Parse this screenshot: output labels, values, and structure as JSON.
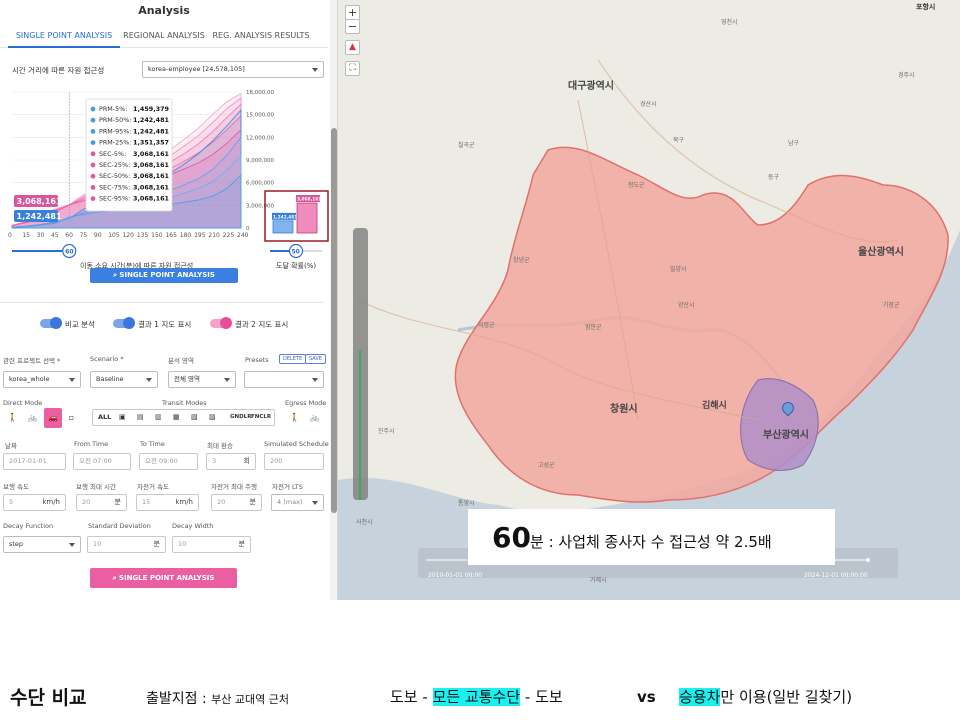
{
  "panel": {
    "title": "Analysis",
    "tabs": [
      {
        "label": "SINGLE POINT ANALYSIS",
        "active": true
      },
      {
        "label": "REGIONAL ANALYSIS",
        "active": false
      },
      {
        "label": "REG. ANALYSIS RESULTS",
        "active": false
      }
    ],
    "chart_section_label": "시간 거리에 따른 자원 접근성",
    "dataset_select": "korea-employee [24,578,105]"
  },
  "chart_data": [
    {
      "type": "area",
      "x": [
        0,
        15,
        30,
        45,
        60,
        75,
        90,
        105,
        120,
        135,
        150,
        165,
        180,
        195,
        210,
        225,
        240
      ],
      "xlabel": "이동 소요 시간(분)에 따른 자원 접근성",
      "ylim": [
        0,
        18000000
      ],
      "yticks": [
        "18,000,00",
        "15,000,00",
        "12,000,00",
        "9,000,000",
        "6,000,000",
        "3,000,000",
        "0"
      ],
      "series": [
        {
          "name": "PRM-5%",
          "values": [
            80000,
            200000,
            380000,
            620000,
            1459379,
            1800000,
            2100000,
            2300000,
            2500000,
            2700000,
            2900000,
            3100000,
            3400000,
            3700000,
            4200000,
            5200000,
            7000000
          ]
        },
        {
          "name": "PRM-50%",
          "values": [
            90000,
            230000,
            430000,
            700000,
            1242481,
            2100000,
            2600000,
            3000000,
            3400000,
            3800000,
            4300000,
            4900000,
            5700000,
            6500000,
            7700000,
            9600000,
            12000000
          ]
        },
        {
          "name": "PRM-95%",
          "values": [
            100000,
            250000,
            470000,
            780000,
            1242481,
            2500000,
            3300000,
            4000000,
            4700000,
            5400000,
            6200000,
            7200000,
            8400000,
            9800000,
            11500000,
            13500000,
            15600000
          ]
        },
        {
          "name": "PRM-25%",
          "values": [
            85000,
            215000,
            400000,
            660000,
            1351357,
            1950000,
            2350000,
            2650000,
            2950000,
            3250000,
            3600000,
            4000000,
            4600000,
            5200000,
            6100000,
            7600000,
            9600000
          ]
        },
        {
          "name": "SEC-5%",
          "values": [
            300000,
            700000,
            1300000,
            2100000,
            3068161,
            3600000,
            4100000,
            4600000,
            5100000,
            5700000,
            6300000,
            7000000,
            7800000,
            8600000,
            9700000,
            11200000,
            13000000
          ]
        },
        {
          "name": "SEC-25%",
          "values": [
            320000,
            740000,
            1380000,
            2200000,
            3068161,
            3800000,
            4400000,
            5000000,
            5600000,
            6300000,
            7000000,
            7800000,
            8800000,
            9900000,
            11300000,
            13000000,
            14800000
          ]
        },
        {
          "name": "SEC-50%",
          "values": [
            340000,
            780000,
            1460000,
            2300000,
            3068161,
            4000000,
            4700000,
            5400000,
            6100000,
            6900000,
            7700000,
            8700000,
            9800000,
            11100000,
            12700000,
            14600000,
            16400000
          ]
        },
        {
          "name": "SEC-75%",
          "values": [
            360000,
            820000,
            1540000,
            2400000,
            3068161,
            4200000,
            5000000,
            5800000,
            6600000,
            7500000,
            8400000,
            9500000,
            10800000,
            12200000,
            13900000,
            15800000,
            17200000
          ]
        },
        {
          "name": "SEC-95%",
          "values": [
            380000,
            860000,
            1620000,
            2500000,
            3068161,
            4400000,
            5300000,
            6200000,
            7100000,
            8100000,
            9100000,
            10300000,
            11700000,
            13200000,
            15000000,
            16700000,
            17800000
          ]
        }
      ],
      "tooltip_at_x": 60,
      "tooltip": [
        {
          "label": "PRM-5%:",
          "value": "1,459,379",
          "color": "#4c9be6"
        },
        {
          "label": "PRM-50%:",
          "value": "1,242,481",
          "color": "#4c9be6"
        },
        {
          "label": "PRM-95%:",
          "value": "1,242,481",
          "color": "#4c9be6"
        },
        {
          "label": "PRM-25%:",
          "value": "1,351,357",
          "color": "#4c9be6"
        },
        {
          "label": "SEC-5%:",
          "value": "3,068,161",
          "color": "#e05a9c"
        },
        {
          "label": "SEC-25%:",
          "value": "3,068,161",
          "color": "#e05a9c"
        },
        {
          "label": "SEC-50%:",
          "value": "3,068,161",
          "color": "#e05a9c"
        },
        {
          "label": "SEC-75%:",
          "value": "3,068,161",
          "color": "#e05a9c"
        },
        {
          "label": "SEC-95%:",
          "value": "3,068,161",
          "color": "#e05a9c"
        }
      ],
      "badges": [
        {
          "value": "3,068,161",
          "color": "#d9559c"
        },
        {
          "value": "1,242,481",
          "color": "#3a7fd9"
        }
      ],
      "slider_value": "60"
    },
    {
      "type": "bar",
      "xlabel": "도달 확률(%)",
      "bars": [
        {
          "value": 1242481,
          "label": "1,242,481",
          "color": "#7fb4ee"
        },
        {
          "value": 3068161,
          "label": "3,068,161",
          "color": "#f08bbd"
        }
      ],
      "ylim": [
        0,
        3600000
      ],
      "slider_value": "50"
    }
  ],
  "buttons": {
    "single_point_top": "SINGLE POINT ANALYSIS",
    "single_point_bottom": "SINGLE POINT ANALYSIS",
    "delete": "DELETE",
    "save": "SAVE"
  },
  "toggles": [
    {
      "label": "비교 분석",
      "color": "blue"
    },
    {
      "label": "결과 1 지도 표시",
      "color": "blue"
    },
    {
      "label": "결과 2 지도 표시",
      "color": "pink"
    }
  ],
  "form": {
    "project_label": "관련 프로젝트 선택 *",
    "project_value": "korea_whole",
    "scenario_label": "Scenario *",
    "scenario_value": "Baseline",
    "area_label": "분석 영역",
    "area_value": "전체 영역",
    "presets_label": "Presets",
    "direct_mode_label": "Direct Mode",
    "transit_modes_label": "Transit Modes",
    "egress_mode_label": "Egress Mode",
    "transit_all": "ALL",
    "transit_gndlr": "GNDLR",
    "transit_fnclr": "FNCLR",
    "date_label": "날짜",
    "date_value": "2017-01-01",
    "from_label": "From Time",
    "from_value": "오전 07:00",
    "to_label": "To Time",
    "to_value": "오전 09:00",
    "transfer_label": "최대 환승",
    "transfer_value": "3",
    "transfer_unit": "회",
    "simulated_label": "Simulated Schedule",
    "simulated_value": "200",
    "walk_speed_label": "보행 속도",
    "walk_speed_value": "5",
    "walk_speed_unit": "km/h",
    "walk_time_label": "보행 최대 시간",
    "walk_time_value": "20",
    "walk_time_unit": "분",
    "bike_speed_label": "자전거 속도",
    "bike_speed_value": "15",
    "bike_speed_unit": "km/h",
    "bike_time_label": "자전거 최대 주행",
    "bike_time_value": "20",
    "bike_time_unit": "분",
    "bike_lts_label": "자전거 LTS",
    "bike_lts_value": "4 (max)",
    "decay_fn_label": "Decay Function",
    "decay_fn_value": "step",
    "std_label": "Standard Deviation",
    "std_value": "10",
    "std_unit": "분",
    "width_label": "Decay Width",
    "width_value": "10",
    "width_unit": "분"
  },
  "map": {
    "zoom_in": "+",
    "zoom_out": "−",
    "cities": [
      {
        "name": "대구광역시"
      },
      {
        "name": "울산광역시"
      },
      {
        "name": "창원시"
      },
      {
        "name": "김해시"
      },
      {
        "name": "부산광역시"
      }
    ],
    "places": [
      "포항시",
      "영천시",
      "경산시",
      "밀양시",
      "양산시",
      "청도군",
      "창녕군",
      "함안군",
      "진주시",
      "고성군",
      "거제시",
      "기장군",
      "칠곡군",
      "경주시",
      "의령군",
      "사천시",
      "통영시",
      "북구",
      "남구",
      "동구"
    ],
    "timeline_start": "2010-01-01 00:00",
    "timeline_end": "2024-12-01 00:00:00",
    "annotation_big": "60",
    "annotation_rest": "분 : 사업체 종사자 수 접근성 약 2.5배",
    "colors": {
      "isochrone": "#f2a8a0",
      "isochrone_border": "#e2706a",
      "overlap": "#b08ec8",
      "sea": "#c6d2dc"
    }
  },
  "caption": {
    "title": "수단 비교",
    "origin": "출발지점 : ",
    "origin_place": "부산 교대역 근처",
    "mode1_a": "도보 - ",
    "mode1_hl": "모든 교통수단",
    "mode1_b": " - 도보",
    "vs": "vs",
    "mode2_hl": "승용차",
    "mode2_b": "만 이용(일반 길찾기)"
  }
}
